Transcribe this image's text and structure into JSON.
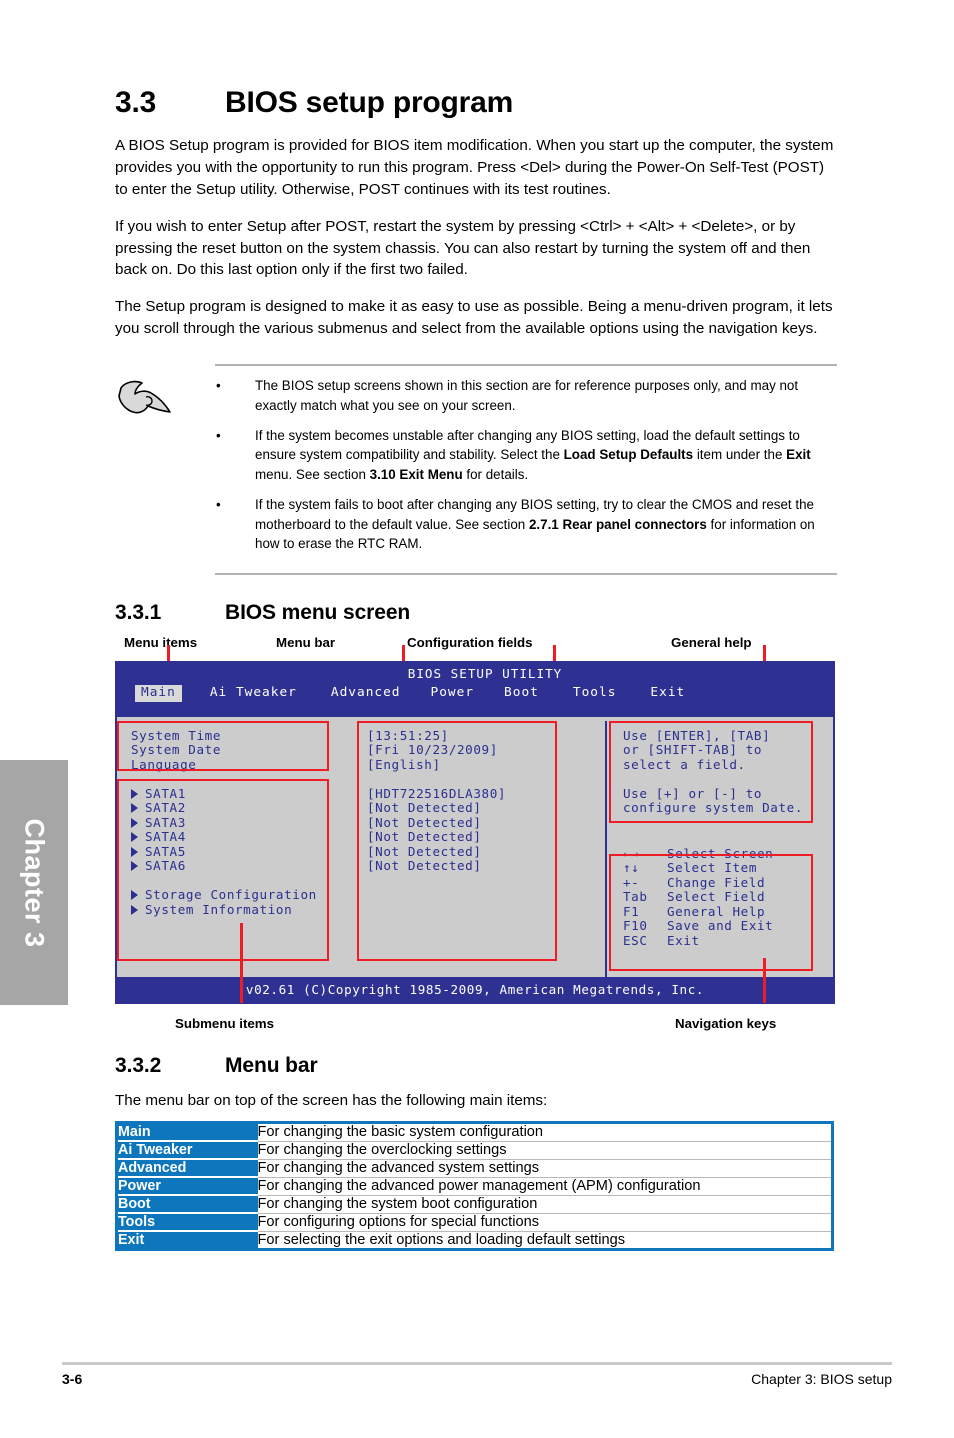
{
  "chapter_tab": "Chapter 3",
  "section": {
    "number": "3.3",
    "title": "BIOS setup program",
    "paragraphs": [
      "A BIOS Setup program is provided for BIOS item modification. When you start up the computer, the system provides you with the opportunity to run this program. Press <Del> during the Power-On Self-Test (POST) to enter the Setup utility. Otherwise, POST continues with its test routines.",
      "If you wish to enter Setup after POST, restart the system by pressing <Ctrl> + <Alt> + <Delete>, or by pressing the reset button on the system chassis. You can also restart by turning the system off and then back on. Do this last option only if the first two failed.",
      "The Setup program is designed to make it as easy to use as possible. Being a menu-driven program, it lets you scroll through the various submenus and select from the available options using the navigation keys."
    ]
  },
  "note": {
    "icon": "pointing-hand-icon",
    "bullet": "•",
    "items": [
      {
        "parts": [
          {
            "text": "The BIOS setup screens shown in this section are for reference purposes only, and may not exactly match what you see on your screen.",
            "bold": false
          }
        ]
      },
      {
        "parts": [
          {
            "text": "If the system becomes unstable after changing any BIOS setting, load the default settings to ensure system compatibility and stability. Select the ",
            "bold": false
          },
          {
            "text": "Load Setup Defaults",
            "bold": true
          },
          {
            "text": " item under the ",
            "bold": false
          },
          {
            "text": "Exit",
            "bold": true
          },
          {
            "text": " menu. See section ",
            "bold": false
          },
          {
            "text": "3.10 Exit Menu",
            "bold": true
          },
          {
            "text": " for details.",
            "bold": false
          }
        ]
      },
      {
        "parts": [
          {
            "text": "If the system fails to boot after changing any BIOS setting, try to clear the CMOS and reset the motherboard to the default value. See section ",
            "bold": false
          },
          {
            "text": "2.7.1 Rear panel connectors",
            "bold": true
          },
          {
            "text": " for information on how to erase the RTC RAM.",
            "bold": false
          }
        ]
      }
    ]
  },
  "subsection_331": {
    "number": "3.3.1",
    "title": "BIOS menu screen"
  },
  "callouts": {
    "menu_items": "Menu items",
    "menu_bar": "Menu bar",
    "configuration_fields": "Configuration fields",
    "general_help": "General help",
    "submenu_items": "Submenu items",
    "navigation_keys": "Navigation keys"
  },
  "bios": {
    "title": "BIOS SETUP UTILITY",
    "tabs": [
      {
        "label": "Main",
        "active": true
      },
      {
        "label": "Ai Tweaker",
        "active": false
      },
      {
        "label": "Advanced",
        "active": false
      },
      {
        "label": "Power",
        "active": false
      },
      {
        "label": "Boot",
        "active": false
      },
      {
        "label": "Tools",
        "active": false
      },
      {
        "label": "Exit",
        "active": false
      }
    ],
    "menu_items": [
      {
        "label": "System Time",
        "submenu": false
      },
      {
        "label": "System Date",
        "submenu": false
      },
      {
        "label": "Language",
        "submenu": false
      }
    ],
    "submenu_items": [
      {
        "label": "SATA1",
        "submenu": true
      },
      {
        "label": "SATA2",
        "submenu": true
      },
      {
        "label": "SATA3",
        "submenu": true
      },
      {
        "label": "SATA4",
        "submenu": true
      },
      {
        "label": "SATA5",
        "submenu": true
      },
      {
        "label": "SATA6",
        "submenu": true
      }
    ],
    "submenu_items2": [
      {
        "label": "Storage Configuration",
        "submenu": true
      },
      {
        "label": "System Information",
        "submenu": true
      }
    ],
    "config_fields_top": [
      "[13:51:25]",
      "[Fri 10/23/2009]",
      "[English]"
    ],
    "config_fields_bottom": [
      "[HDT722516DLA380]",
      "[Not Detected]",
      "[Not Detected]",
      "[Not Detected]",
      "[Not Detected]",
      "[Not Detected]"
    ],
    "general_help": [
      "Use [ENTER], [TAB]",
      "or [SHIFT-TAB] to",
      "select a field.",
      "",
      "Use [+] or [-] to",
      "configure system Date."
    ],
    "navigation_keys": [
      {
        "key": "←→",
        "action": "Select Screen"
      },
      {
        "key": "↑↓",
        "action": "Select Item"
      },
      {
        "key": "+-",
        "action": "Change Field"
      },
      {
        "key": "Tab",
        "action": "Select Field"
      },
      {
        "key": "F1",
        "action": "General Help"
      },
      {
        "key": "F10",
        "action": "Save and Exit"
      },
      {
        "key": "ESC",
        "action": "Exit"
      }
    ],
    "footer": "v02.61 (C)Copyright 1985-2009, American Megatrends, Inc."
  },
  "subsection_332": {
    "number": "3.3.2",
    "title": "Menu bar",
    "intro": "The menu bar on top of the screen has the following main items:",
    "rows": [
      {
        "key": "Main",
        "value": "For changing the basic system configuration"
      },
      {
        "key": "Ai Tweaker",
        "value": "For changing the overclocking settings"
      },
      {
        "key": "Advanced",
        "value": "For changing the advanced system settings"
      },
      {
        "key": "Power",
        "value": "For changing the advanced power management (APM) configuration"
      },
      {
        "key": "Boot",
        "value": "For changing the system boot configuration"
      },
      {
        "key": "Tools",
        "value": "For configuring options for special functions"
      },
      {
        "key": "Exit",
        "value": "For selecting the exit options and loading default settings"
      }
    ]
  },
  "page_footer": {
    "page_number": "3-6",
    "chapter_label": "Chapter 3: BIOS setup"
  },
  "colors": {
    "bios_blue": "#2e3192",
    "bios_bg": "#cccccc",
    "annotation_red": "#ee1c25",
    "table_blue": "#0d76bc",
    "tab_gray": "#a6a6a6"
  }
}
